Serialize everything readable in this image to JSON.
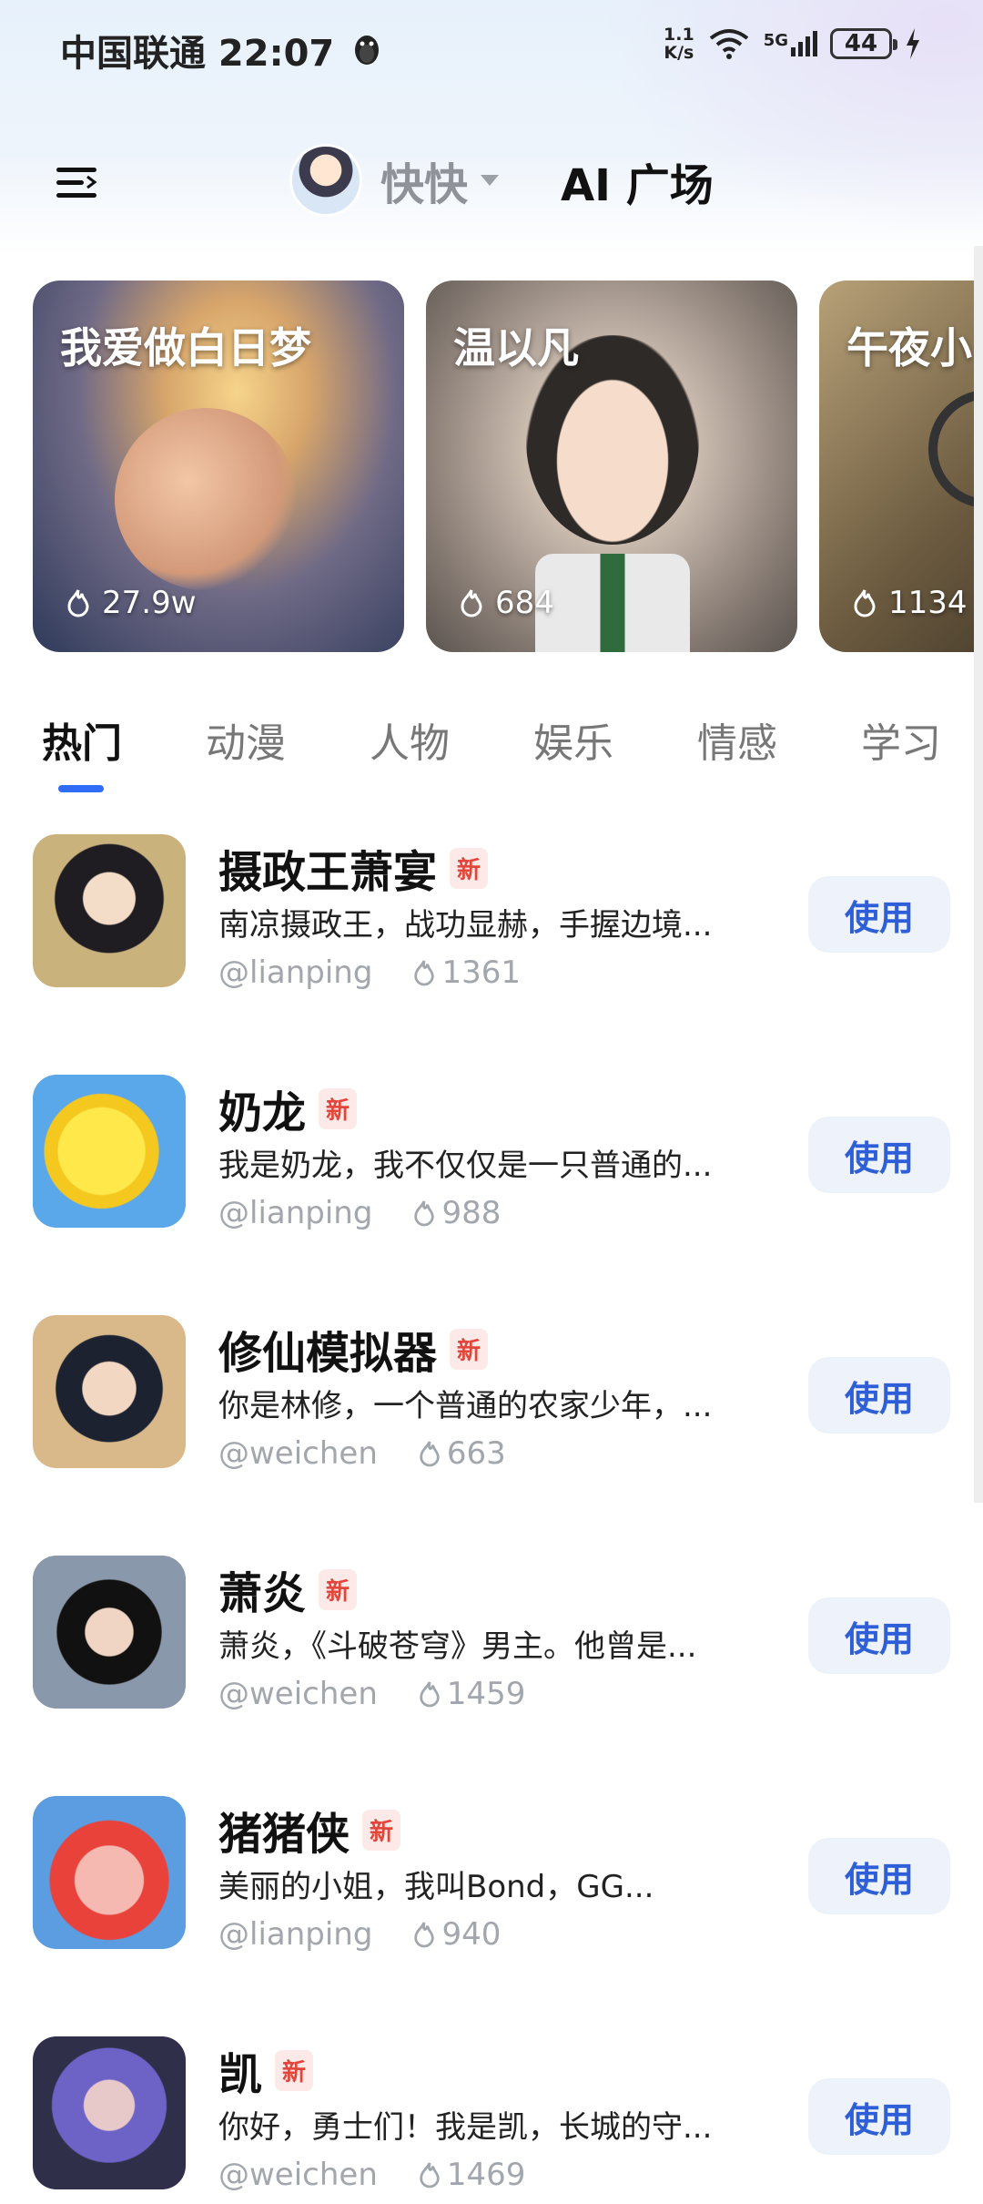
{
  "status": {
    "carrier_time": "中国联通 22:07",
    "net_speed_value": "1.1",
    "net_speed_unit": "K/s",
    "signal_label": "5G",
    "battery": "44"
  },
  "header": {
    "model_name": "快快",
    "title": "AI 广场"
  },
  "featured": [
    {
      "title": "我爱做白日梦",
      "count": "27.9w"
    },
    {
      "title": "温以凡",
      "count": "684"
    },
    {
      "title": "午夜小",
      "count": "1134"
    }
  ],
  "tabs": [
    "热门",
    "动漫",
    "人物",
    "娱乐",
    "情感",
    "学习"
  ],
  "items": [
    {
      "name": "摄政王萧宴",
      "badge": "新",
      "desc": "南凉摄政王，战功显赫，手握边境...",
      "author": "@lianping",
      "count": "1361",
      "button": "使用"
    },
    {
      "name": "奶龙",
      "badge": "新",
      "desc": "我是奶龙，我不仅仅是一只普通的...",
      "author": "@lianping",
      "count": "988",
      "button": "使用"
    },
    {
      "name": "修仙模拟器",
      "badge": "新",
      "desc": "你是林修，一个普通的农家少年，...",
      "author": "@weichen",
      "count": "663",
      "button": "使用"
    },
    {
      "name": "萧炎",
      "badge": "新",
      "desc": "萧炎，《斗破苍穹》男主。他曾是...",
      "author": "@weichen",
      "count": "1459",
      "button": "使用"
    },
    {
      "name": "猪猪侠",
      "badge": "新",
      "desc": "美丽的小姐，我叫Bond，GG...",
      "author": "@lianping",
      "count": "940",
      "button": "使用"
    },
    {
      "name": "凯",
      "badge": "新",
      "desc": "你好，勇士们！我是凯，长城的守...",
      "author": "@weichen",
      "count": "1469",
      "button": "使用"
    }
  ],
  "colors": {
    "accent": "#2f6df6",
    "use_button_text": "#2f5fd6",
    "new_badge": "#e0463a"
  }
}
